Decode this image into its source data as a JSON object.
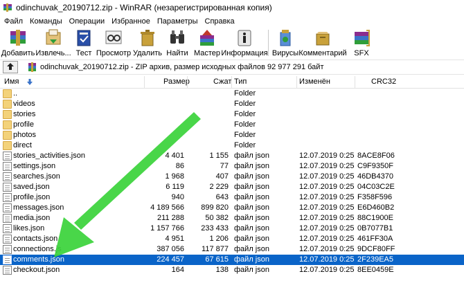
{
  "window": {
    "title": "odinchuvak_20190712.zip - WinRAR (незарегистрированная копия)"
  },
  "menu": [
    "Файл",
    "Команды",
    "Операции",
    "Избранное",
    "Параметры",
    "Справка"
  ],
  "toolbar": [
    {
      "label": "Добавить",
      "icon": "add-archive-icon"
    },
    {
      "label": "Извлечь...",
      "icon": "extract-icon"
    },
    {
      "label": "Тест",
      "icon": "test-icon"
    },
    {
      "label": "Просмотр",
      "icon": "view-icon"
    },
    {
      "label": "Удалить",
      "icon": "delete-icon"
    },
    {
      "label": "Найти",
      "icon": "find-icon"
    },
    {
      "label": "Мастер",
      "icon": "wizard-icon"
    },
    {
      "label": "Информация",
      "icon": "info-icon"
    },
    {
      "label": "Вирусы",
      "icon": "virus-scan-icon"
    },
    {
      "label": "Комментарий",
      "icon": "comment-icon"
    },
    {
      "label": "SFX",
      "icon": "sfx-icon"
    }
  ],
  "address": {
    "path": "odinchuvak_20190712.zip - ZIP архив, размер исходных файлов 92 977 291 байт"
  },
  "columns": {
    "name": "Имя",
    "size": "Размер",
    "packed": "Сжат",
    "type": "Тип",
    "modified": "Изменён",
    "crc": "CRC32"
  },
  "files": [
    {
      "name": "..",
      "size": "",
      "packed": "",
      "type": "Folder",
      "modified": "",
      "crc": "",
      "kind": "up"
    },
    {
      "name": "videos",
      "size": "",
      "packed": "",
      "type": "Folder",
      "modified": "",
      "crc": "",
      "kind": "folder"
    },
    {
      "name": "stories",
      "size": "",
      "packed": "",
      "type": "Folder",
      "modified": "",
      "crc": "",
      "kind": "folder"
    },
    {
      "name": "profile",
      "size": "",
      "packed": "",
      "type": "Folder",
      "modified": "",
      "crc": "",
      "kind": "folder"
    },
    {
      "name": "photos",
      "size": "",
      "packed": "",
      "type": "Folder",
      "modified": "",
      "crc": "",
      "kind": "folder"
    },
    {
      "name": "direct",
      "size": "",
      "packed": "",
      "type": "Folder",
      "modified": "",
      "crc": "",
      "kind": "folder"
    },
    {
      "name": "stories_activities.json",
      "size": "4 401",
      "packed": "1 155",
      "type": "файл json",
      "modified": "12.07.2019 0:25",
      "crc": "8ACE8F06",
      "kind": "file"
    },
    {
      "name": "settings.json",
      "size": "86",
      "packed": "77",
      "type": "файл json",
      "modified": "12.07.2019 0:25",
      "crc": "C9F9350F",
      "kind": "file"
    },
    {
      "name": "searches.json",
      "size": "1 968",
      "packed": "407",
      "type": "файл json",
      "modified": "12.07.2019 0:25",
      "crc": "46DB4370",
      "kind": "file"
    },
    {
      "name": "saved.json",
      "size": "6 119",
      "packed": "2 229",
      "type": "файл json",
      "modified": "12.07.2019 0:25",
      "crc": "04C03C2E",
      "kind": "file"
    },
    {
      "name": "profile.json",
      "size": "940",
      "packed": "643",
      "type": "файл json",
      "modified": "12.07.2019 0:25",
      "crc": "F358F596",
      "kind": "file"
    },
    {
      "name": "messages.json",
      "size": "4 189 566",
      "packed": "899 820",
      "type": "файл json",
      "modified": "12.07.2019 0:25",
      "crc": "E6D460B2",
      "kind": "file"
    },
    {
      "name": "media.json",
      "size": "211 288",
      "packed": "50 382",
      "type": "файл json",
      "modified": "12.07.2019 0:25",
      "crc": "88C1900E",
      "kind": "file"
    },
    {
      "name": "likes.json",
      "size": "1 157 766",
      "packed": "233 433",
      "type": "файл json",
      "modified": "12.07.2019 0:25",
      "crc": "0B7077B1",
      "kind": "file"
    },
    {
      "name": "contacts.json",
      "size": "4 951",
      "packed": "1 206",
      "type": "файл json",
      "modified": "12.07.2019 0:25",
      "crc": "461FF30A",
      "kind": "file"
    },
    {
      "name": "connections.js",
      "size": "387 056",
      "packed": "117 877",
      "type": "файл json",
      "modified": "12.07.2019 0:25",
      "crc": "9DCF80FF",
      "kind": "file"
    },
    {
      "name": "comments.json",
      "size": "224 457",
      "packed": "67 615",
      "type": "файл json",
      "modified": "12.07.2019 0:25",
      "crc": "2F239EA5",
      "kind": "file",
      "selected": true
    },
    {
      "name": "checkout.json",
      "size": "164",
      "packed": "138",
      "type": "файл json",
      "modified": "12.07.2019 0:25",
      "crc": "8EE0459E",
      "kind": "file"
    }
  ],
  "colors": {
    "selection": "#0a64c8",
    "arrow": "#3ad23a",
    "folder": "#f3d27a"
  }
}
